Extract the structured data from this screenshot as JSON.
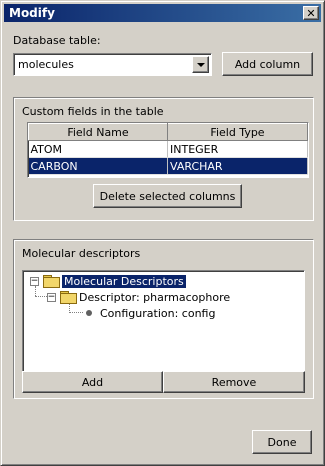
{
  "window": {
    "title": "Modify",
    "close_glyph": "✕"
  },
  "database": {
    "label": "Database table:",
    "selected": "molecules",
    "add_column_label": "Add column"
  },
  "custom_fields": {
    "legend": "Custom fields in the table",
    "columns": [
      "Field Name",
      "Field Type"
    ],
    "rows": [
      {
        "name": "ATOM",
        "type": "INTEGER",
        "selected": false
      },
      {
        "name": "CARBON",
        "type": "VARCHAR",
        "selected": true
      }
    ],
    "delete_label": "Delete selected columns"
  },
  "descriptors": {
    "legend": "Molecular descriptors",
    "tree": [
      {
        "label": "Molecular Descriptors",
        "icon": "folder-icon",
        "expander": "−",
        "selected": true
      },
      {
        "label": "Descriptor: pharmacophore",
        "icon": "folder-icon",
        "expander": "−",
        "selected": false
      },
      {
        "label": "Configuration: config",
        "icon": "bullet-icon",
        "selected": false
      }
    ],
    "add_label": "Add",
    "remove_label": "Remove"
  },
  "footer": {
    "done_label": "Done"
  }
}
